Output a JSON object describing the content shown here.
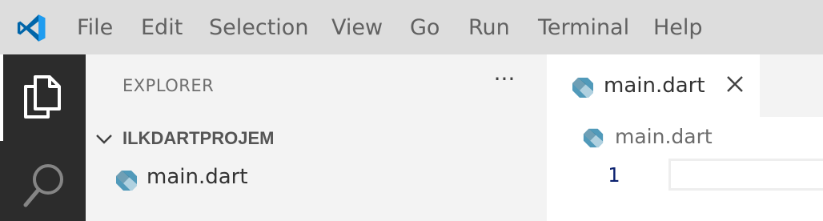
{
  "menubar": {
    "logo_icon": "vscode-logo-icon",
    "items": [
      "File",
      "Edit",
      "Selection",
      "View",
      "Go",
      "Run",
      "Terminal",
      "Help"
    ]
  },
  "activitybar": {
    "items": [
      {
        "icon": "files-icon",
        "active": true
      },
      {
        "icon": "search-icon",
        "active": false
      }
    ]
  },
  "sidebar": {
    "title": "EXPLORER",
    "more_actions": "···",
    "folder": {
      "name": "ILKDARTPROJEM",
      "expanded": true
    },
    "files": [
      {
        "name": "main.dart",
        "icon": "dart-file-icon"
      }
    ]
  },
  "editor": {
    "tabs": [
      {
        "label": "main.dart",
        "icon": "dart-file-icon",
        "active": true
      }
    ],
    "breadcrumb": {
      "file": "main.dart"
    },
    "lines": [
      {
        "number": "1",
        "text": ""
      }
    ]
  },
  "colors": {
    "menubar_bg": "#dddddd",
    "activitybar_bg": "#2c2c2c",
    "sidebar_bg": "#f3f3f3",
    "editor_bg": "#ffffff",
    "vscode_blue": "#0065a9",
    "dart_icon": "#519aba",
    "line_number": "#0b216f"
  }
}
